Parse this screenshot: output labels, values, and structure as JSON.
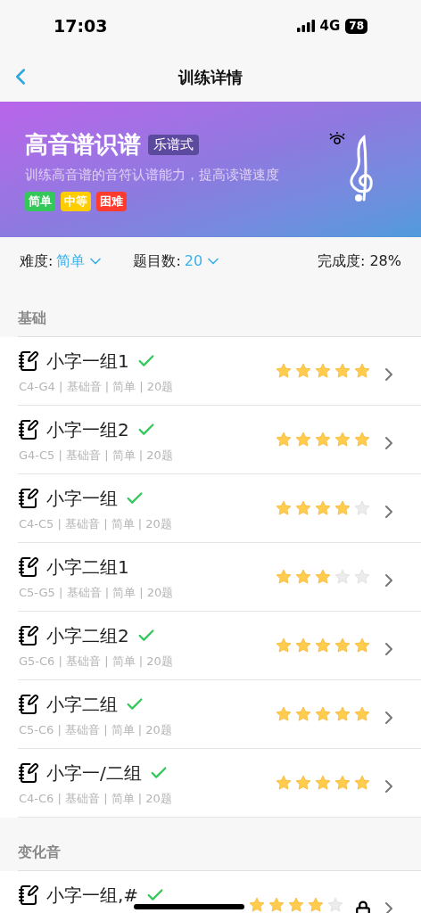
{
  "status_bar": {
    "time": "17:03",
    "network": "4G",
    "battery": "78"
  },
  "nav": {
    "title": "训练详情"
  },
  "banner": {
    "title": "高音谱识谱",
    "badge": "乐谱式",
    "description": "训练高音谱的音符认谱能力，提高读谱速度",
    "tags": [
      {
        "label": "简单",
        "color": "#34c759"
      },
      {
        "label": "中等",
        "color": "#ffcc00"
      },
      {
        "label": "困难",
        "color": "#ff3b30"
      }
    ]
  },
  "filters": {
    "difficulty_label": "难度:",
    "difficulty": "简单",
    "count_label": "题目数:",
    "count": "20",
    "progress": "完成度: 28%"
  },
  "sections": [
    {
      "title": "基础",
      "items": [
        {
          "name": "小字一组1",
          "done": true,
          "subtitle": "C4-G4 | 基础音 | 简单 | 20题",
          "stars": 5,
          "locked": false
        },
        {
          "name": "小字一组2",
          "done": true,
          "subtitle": "G4-C5 | 基础音 | 简单 | 20题",
          "stars": 5,
          "locked": false
        },
        {
          "name": "小字一组",
          "done": true,
          "subtitle": "C4-C5 | 基础音 | 简单 | 20题",
          "stars": 4,
          "locked": false
        },
        {
          "name": "小字二组1",
          "done": false,
          "subtitle": "C5-G5 | 基础音 | 简单 | 20题",
          "stars": 3,
          "locked": false
        },
        {
          "name": "小字二组2",
          "done": true,
          "subtitle": "G5-C6 | 基础音 | 简单 | 20题",
          "stars": 5,
          "locked": false
        },
        {
          "name": "小字二组",
          "done": true,
          "subtitle": "C5-C6 | 基础音 | 简单 | 20题",
          "stars": 5,
          "locked": false
        },
        {
          "name": "小字一/二组",
          "done": true,
          "subtitle": "C4-C6 | 基础音 | 简单 | 20题",
          "stars": 5,
          "locked": false
        }
      ]
    },
    {
      "title": "变化音",
      "items": [
        {
          "name": "小字一组,#",
          "done": true,
          "stars": 4,
          "locked": true
        }
      ]
    }
  ]
}
